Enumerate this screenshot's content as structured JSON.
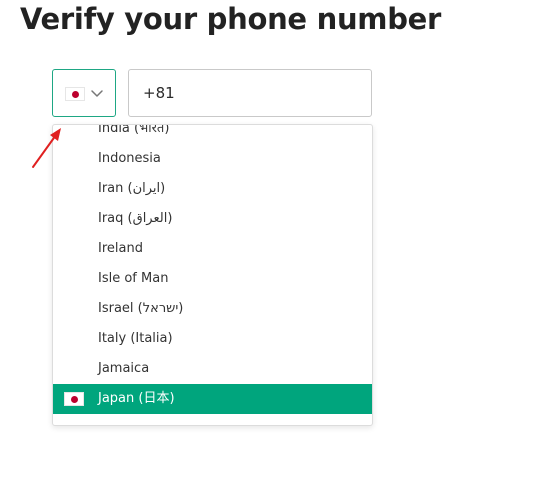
{
  "title": "Verify your phone number",
  "country_select": {
    "selected_flag": "japan-flag",
    "chevron": "chevron-down-icon",
    "border_color": "#1ea784"
  },
  "phone": {
    "value": "+81"
  },
  "annotation": {
    "arrow_color": "#e02020"
  },
  "dropdown": {
    "selected_color": "#00a57d",
    "items": [
      {
        "label": "India (भारत)"
      },
      {
        "label": "Indonesia"
      },
      {
        "label": "Iran (‫ایران‬‎)"
      },
      {
        "label": "Iraq (‫العراق‬‎)"
      },
      {
        "label": "Ireland"
      },
      {
        "label": "Isle of Man"
      },
      {
        "label": "Israel (‫ישראל‬‎)"
      },
      {
        "label": "Italy (Italia)"
      },
      {
        "label": "Jamaica"
      },
      {
        "label": "Japan (日本)",
        "selected": true,
        "flag": "japan-flag"
      }
    ]
  }
}
